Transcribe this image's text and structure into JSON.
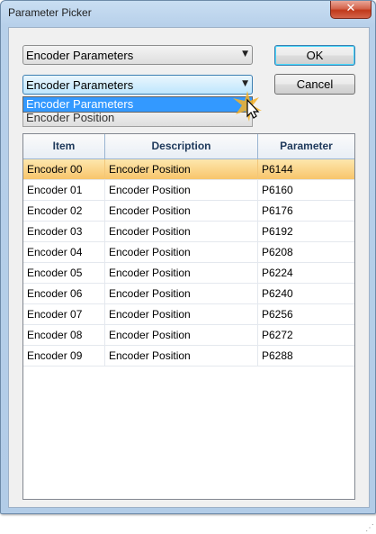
{
  "window": {
    "title": "Parameter Picker",
    "close_label": "✕"
  },
  "category_combo": {
    "value": "Encoder Parameters"
  },
  "param_combo": {
    "value": "Encoder Parameters"
  },
  "dropdown": {
    "items": [
      "Encoder Parameters"
    ]
  },
  "behind_field": {
    "value": "Encoder Position"
  },
  "buttons": {
    "ok": "OK",
    "cancel": "Cancel"
  },
  "table": {
    "headers": [
      "Item",
      "Description",
      "Parameter"
    ],
    "rows": [
      [
        "Encoder 00",
        "Encoder Position",
        "P6144"
      ],
      [
        "Encoder 01",
        "Encoder Position",
        "P6160"
      ],
      [
        "Encoder 02",
        "Encoder Position",
        "P6176"
      ],
      [
        "Encoder 03",
        "Encoder Position",
        "P6192"
      ],
      [
        "Encoder 04",
        "Encoder Position",
        "P6208"
      ],
      [
        "Encoder 05",
        "Encoder Position",
        "P6224"
      ],
      [
        "Encoder 06",
        "Encoder Position",
        "P6240"
      ],
      [
        "Encoder 07",
        "Encoder Position",
        "P6256"
      ],
      [
        "Encoder 08",
        "Encoder Position",
        "P6272"
      ],
      [
        "Encoder 09",
        "Encoder Position",
        "P6288"
      ]
    ],
    "selected_row": 0
  },
  "colors": {
    "selection": "#3399ff",
    "row_highlight": "#f8c56b"
  }
}
